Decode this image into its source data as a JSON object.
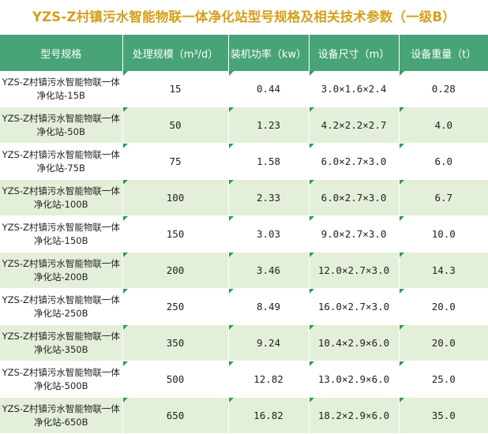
{
  "title": "YZS-Z村镇污水智能物联一体净化站型号规格及相关技术参数（一级B）",
  "table": {
    "headers": [
      "型号规格",
      "处理规模（m³/d）",
      "装机功率（kw）",
      "设备尺寸（m）",
      "设备重量（t）"
    ],
    "rows": [
      {
        "model": "YZS-Z村镇污水智能物联一体净化站-15B",
        "capacity": "15",
        "power": "0.44",
        "size": "3.0×1.6×2.4",
        "weight": "0.28"
      },
      {
        "model": "YZS-Z村镇污水智能物联一体净化站-50B",
        "capacity": "50",
        "power": "1.23",
        "size": "4.2×2.2×2.7",
        "weight": "4.0"
      },
      {
        "model": "YZS-Z村镇污水智能物联一体净化站-75B",
        "capacity": "75",
        "power": "1.58",
        "size": "6.0×2.7×3.0",
        "weight": "6.0"
      },
      {
        "model": "YZS-Z村镇污水智能物联一体净化站-100B",
        "capacity": "100",
        "power": "2.33",
        "size": "6.0×2.7×3.0",
        "weight": "6.7"
      },
      {
        "model": "YZS-Z村镇污水智能物联一体净化站-150B",
        "capacity": "150",
        "power": "3.03",
        "size": "9.0×2.7×3.0",
        "weight": "10.0"
      },
      {
        "model": "YZS-Z村镇污水智能物联一体净化站-200B",
        "capacity": "200",
        "power": "3.46",
        "size": "12.0×2.7×3.0",
        "weight": "14.3"
      },
      {
        "model": "YZS-Z村镇污水智能物联一体净化站-250B",
        "capacity": "250",
        "power": "8.49",
        "size": "16.0×2.7×3.0",
        "weight": "20.0"
      },
      {
        "model": "YZS-Z村镇污水智能物联一体净化站-350B",
        "capacity": "350",
        "power": "9.24",
        "size": "10.4×2.9×6.0",
        "weight": "20.0"
      },
      {
        "model": "YZS-Z村镇污水智能物联一体净化站-500B",
        "capacity": "500",
        "power": "12.82",
        "size": "13.0×2.9×6.0",
        "weight": "25.0"
      },
      {
        "model": "YZS-Z村镇污水智能物联一体净化站-650B",
        "capacity": "650",
        "power": "16.82",
        "size": "18.2×2.9×6.0",
        "weight": "35.0"
      }
    ]
  },
  "colors": {
    "title": "#d4a01a",
    "header_bg": "#48a477",
    "row_alt_bg": "#e4efd9",
    "corner_mark": "#2f9a5a"
  }
}
